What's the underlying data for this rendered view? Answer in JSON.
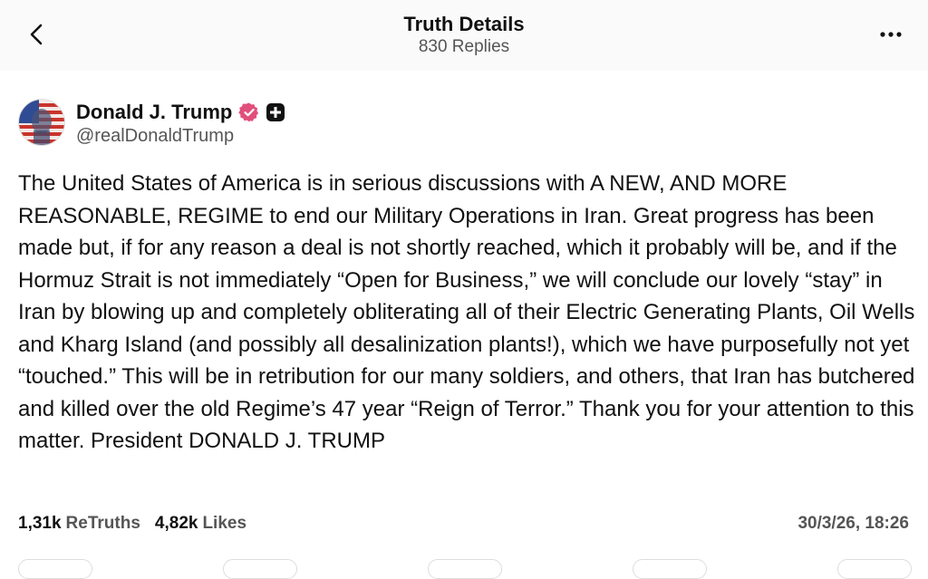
{
  "header": {
    "title": "Truth Details",
    "replies": "830 Replies",
    "back_icon": "chevron-left-icon",
    "more_icon": "ellipsis-icon"
  },
  "author": {
    "display_name": "Donald J. Trump",
    "handle": "@realDonaldTrump",
    "verified_color": "#e0507a",
    "badge_icon": "plus-badge-icon"
  },
  "post": {
    "text": "The United States of America is in serious discussions with A NEW, AND MORE REASONABLE, REGIME to end our Military Operations in Iran. Great progress has been made but, if for any reason a deal is not shortly reached, which it probably will be, and if the Hormuz Strait is not immediately “Open for Business,” we will conclude our lovely “stay” in Iran by blowing up and completely obliterating all of their Electric Generating Plants, Oil Wells and Kharg Island (and possibly all desalinization plants!), which we have purposefully not yet “touched.” This will be in retribution for our many soldiers, and others, that Iran has butchered and killed over the old Regime’s 47 year “Reign of Terror.” Thank you for your attention to this matter. President DONALD J. TRUMP"
  },
  "stats": {
    "retruths_count": "1,31k",
    "retruths_label": "ReTruths",
    "likes_count": "4,82k",
    "likes_label": "Likes",
    "timestamp": "30/3/26, 18:26"
  }
}
